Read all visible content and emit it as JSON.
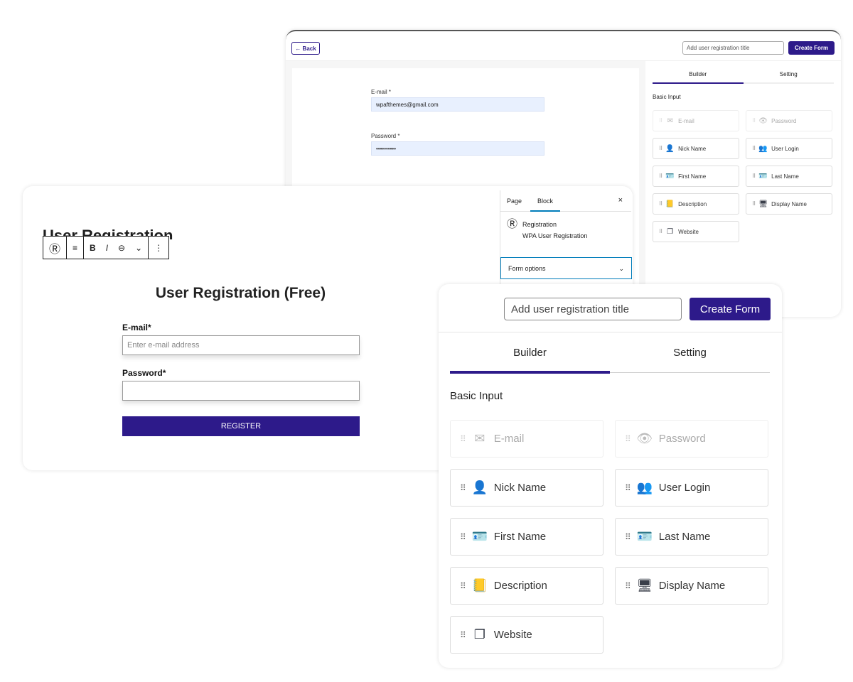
{
  "builder_small": {
    "back_label": "Back",
    "back_icon": "←",
    "title_placeholder": "Add user registration title",
    "create_label": "Create Form",
    "preview": {
      "email_label": "E-mail *",
      "email_value": "wpafthemes@gmail.com",
      "password_label": "Password *",
      "password_value": "••••••••••"
    },
    "tabs": [
      "Builder",
      "Setting"
    ],
    "active_tab": "Builder",
    "section": "Basic Input"
  },
  "fields": [
    {
      "label": "E-mail",
      "icon": "envelope-icon",
      "glyph": "✉",
      "disabled": true
    },
    {
      "label": "Password",
      "icon": "eye-icon",
      "glyph": "👁",
      "disabled": true
    },
    {
      "label": "Nick Name",
      "icon": "user-tag-icon",
      "glyph": "👤",
      "disabled": false
    },
    {
      "label": "User Login",
      "icon": "user-lock-icon",
      "glyph": "👥",
      "disabled": false
    },
    {
      "label": "First Name",
      "icon": "id-card-icon",
      "glyph": "🪪",
      "disabled": false
    },
    {
      "label": "Last Name",
      "icon": "id-card-icon",
      "glyph": "🪪",
      "disabled": false
    },
    {
      "label": "Description",
      "icon": "address-book-icon",
      "glyph": "📒",
      "disabled": false
    },
    {
      "label": "Display Name",
      "icon": "chalkboard-user-icon",
      "glyph": "🖥",
      "disabled": false
    },
    {
      "label": "Website",
      "icon": "clone-icon",
      "glyph": "❐",
      "disabled": false
    }
  ],
  "editor": {
    "heading": "User Registration",
    "toolbar": {
      "bold": "B",
      "italic": "I",
      "link": "⊖",
      "more": "⌄",
      "options": "⋮",
      "align": "≡"
    },
    "form_title": "User Registration (Free)",
    "email_label": "E-mail*",
    "email_placeholder": "Enter e-mail address",
    "password_label": "Password*",
    "register_label": "REGISTER",
    "sidebar": {
      "tabs": [
        "Page",
        "Block"
      ],
      "active_tab": "Block",
      "close": "×",
      "block_name": "Registration",
      "block_desc": "WPA User Registration",
      "form_options": "Form options",
      "chevron": "⌄"
    }
  },
  "builder_large": {
    "title_placeholder": "Add user registration title",
    "create_label": "Create Form",
    "tabs": [
      "Builder",
      "Setting"
    ],
    "active_tab": "Builder",
    "section": "Basic Input"
  },
  "colors": {
    "accent": "#2d1a8a",
    "wp_blue": "#007cba",
    "input_fill": "#e8f0fe"
  }
}
